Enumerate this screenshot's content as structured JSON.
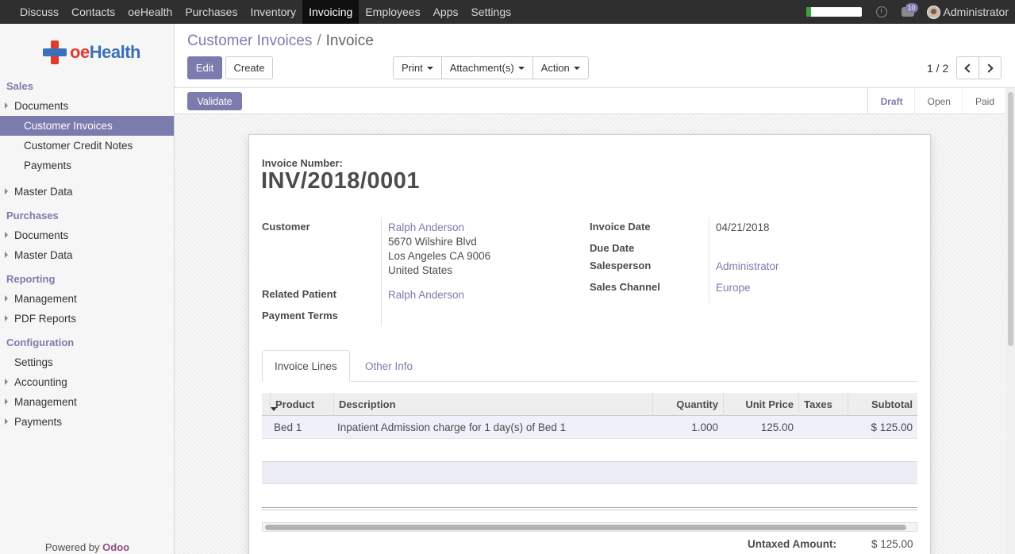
{
  "topbar": {
    "menu": [
      "Discuss",
      "Contacts",
      "oeHealth",
      "Purchases",
      "Inventory",
      "Invoicing",
      "Employees",
      "Apps",
      "Settings"
    ],
    "active": "Invoicing",
    "chat_badge": "10",
    "user": "Administrator"
  },
  "sidebar": {
    "logo_oe": "oe",
    "logo_health": "Health",
    "sales": "Sales",
    "sales_documents": "Documents",
    "customer_invoices": "Customer Invoices",
    "customer_credit_notes": "Customer Credit Notes",
    "payments": "Payments",
    "sales_master_data": "Master Data",
    "purchases": "Purchases",
    "purchases_documents": "Documents",
    "purchases_master_data": "Master Data",
    "reporting": "Reporting",
    "reporting_management": "Management",
    "pdf_reports": "PDF Reports",
    "configuration": "Configuration",
    "config_settings": "Settings",
    "config_accounting": "Accounting",
    "config_management": "Management",
    "config_payments": "Payments",
    "powered_by": "Powered by",
    "odoo": "Odoo"
  },
  "control_panel": {
    "breadcrumb_parent": "Customer Invoices",
    "breadcrumb_sep": "/",
    "breadcrumb_current": "Invoice",
    "edit": "Edit",
    "create": "Create",
    "print": "Print",
    "attachments": "Attachment(s)",
    "action": "Action",
    "pager": "1 / 2"
  },
  "statusbar": {
    "validate": "Validate",
    "steps": [
      "Draft",
      "Open",
      "Paid"
    ],
    "current": "Draft"
  },
  "invoice": {
    "number_label": "Invoice Number:",
    "number": "INV/2018/0001",
    "customer_label": "Customer",
    "customer_name": "Ralph Anderson",
    "customer_street": "5670 Wilshire Blvd",
    "customer_city": "Los Angeles CA 9006",
    "customer_country": "United States",
    "related_patient_label": "Related Patient",
    "related_patient": "Ralph Anderson",
    "payment_terms_label": "Payment Terms",
    "invoice_date_label": "Invoice Date",
    "invoice_date": "04/21/2018",
    "due_date_label": "Due Date",
    "salesperson_label": "Salesperson",
    "salesperson": "Administrator",
    "sales_channel_label": "Sales Channel",
    "sales_channel": "Europe"
  },
  "tabs": {
    "invoice_lines": "Invoice Lines",
    "other_info": "Other Info"
  },
  "lines": {
    "headers": {
      "product": "Product",
      "description": "Description",
      "quantity": "Quantity",
      "unit_price": "Unit Price",
      "taxes": "Taxes",
      "subtotal": "Subtotal"
    },
    "rows": [
      {
        "product": "Bed 1",
        "description": "Inpatient Admission charge for 1 day(s) of Bed 1",
        "quantity": "1.000",
        "unit_price": "125.00",
        "taxes": "",
        "subtotal": "$ 125.00"
      }
    ]
  },
  "totals": {
    "untaxed_label": "Untaxed Amount:",
    "untaxed_value": "$ 125.00"
  },
  "colors": {
    "accent": "#7c7bad",
    "topbar": "#2f2f2f"
  }
}
